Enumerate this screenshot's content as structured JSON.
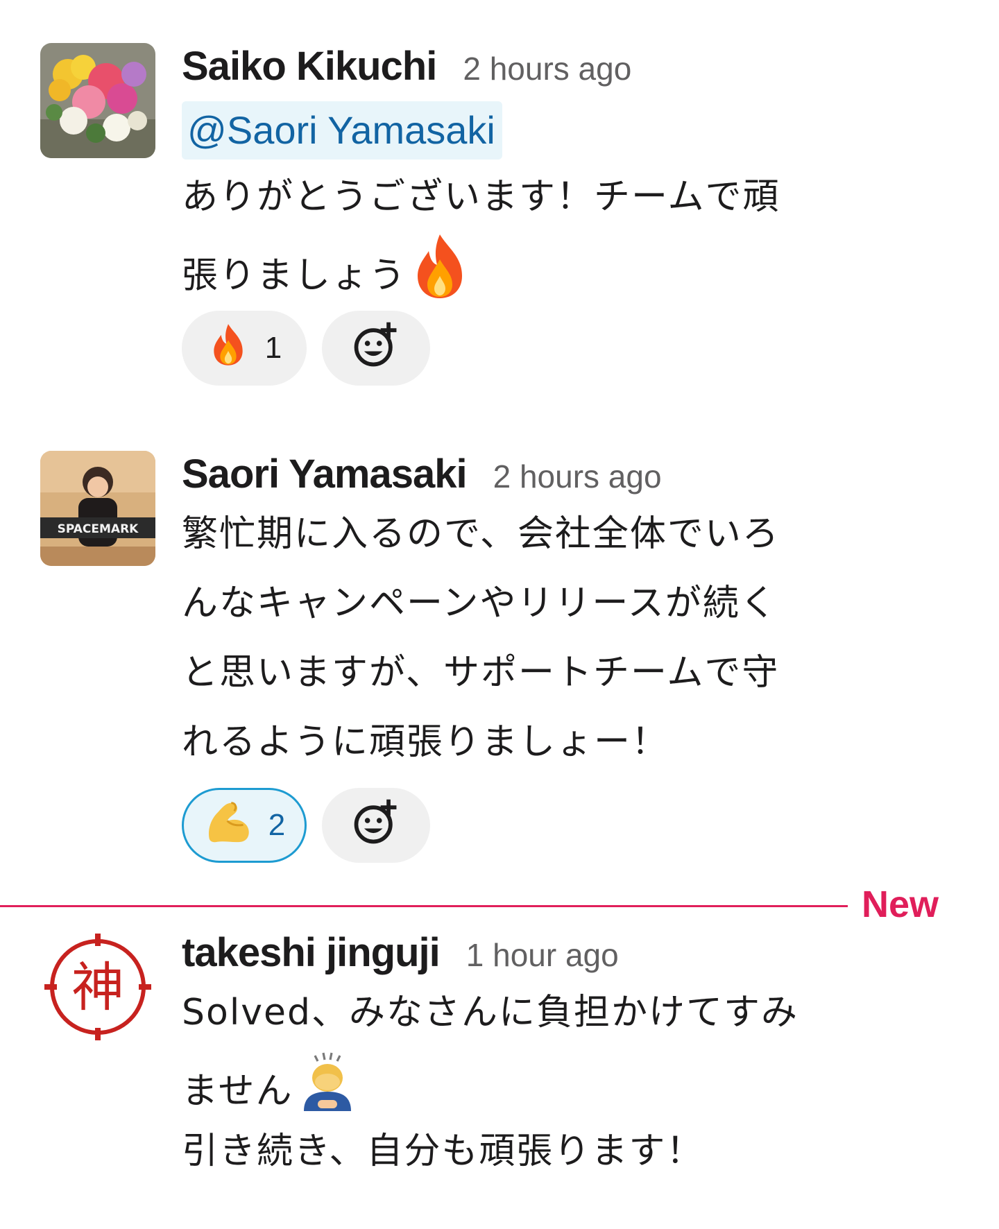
{
  "messages": [
    {
      "author": "Saiko Kikuchi",
      "timestamp": "2 hours ago",
      "mention": "@Saori Yamasaki",
      "lines": [
        "ありがとうございます！チームで頑",
        "張りましょう"
      ],
      "trailing_emoji": "fire-emoji",
      "reactions": [
        {
          "emoji": "fire-emoji",
          "count": "1",
          "active": false
        }
      ]
    },
    {
      "author": "Saori Yamasaki",
      "timestamp": "2 hours ago",
      "avatar_text": "SPACEMARK",
      "lines": [
        "繁忙期に入るので、会社全体でいろ",
        "んなキャンペーンやリリースが続く",
        "と思いますが、サポートチームで守",
        "れるように頑張りましょー！"
      ],
      "reactions": [
        {
          "emoji": "flexed-biceps-emoji",
          "count": "2",
          "active": true
        }
      ]
    },
    {
      "author": "takeshi jinguji",
      "timestamp": "1 hour ago",
      "avatar_text": "神",
      "lines": [
        "Solved、みなさんに負担かけてすみ",
        "ません",
        "引き続き、自分も頑張ります！"
      ],
      "trailing_emoji": "bowing-person-emoji"
    }
  ],
  "divider": {
    "label": "New",
    "color": "#e01e5a"
  },
  "colors": {
    "mention_bg": "#e8f5fa",
    "mention_text": "#1264a3",
    "reaction_active_border": "#1d9bd1",
    "reaction_bg": "#f0f0f0"
  },
  "icons": {
    "add_reaction": "add-reaction-icon"
  }
}
